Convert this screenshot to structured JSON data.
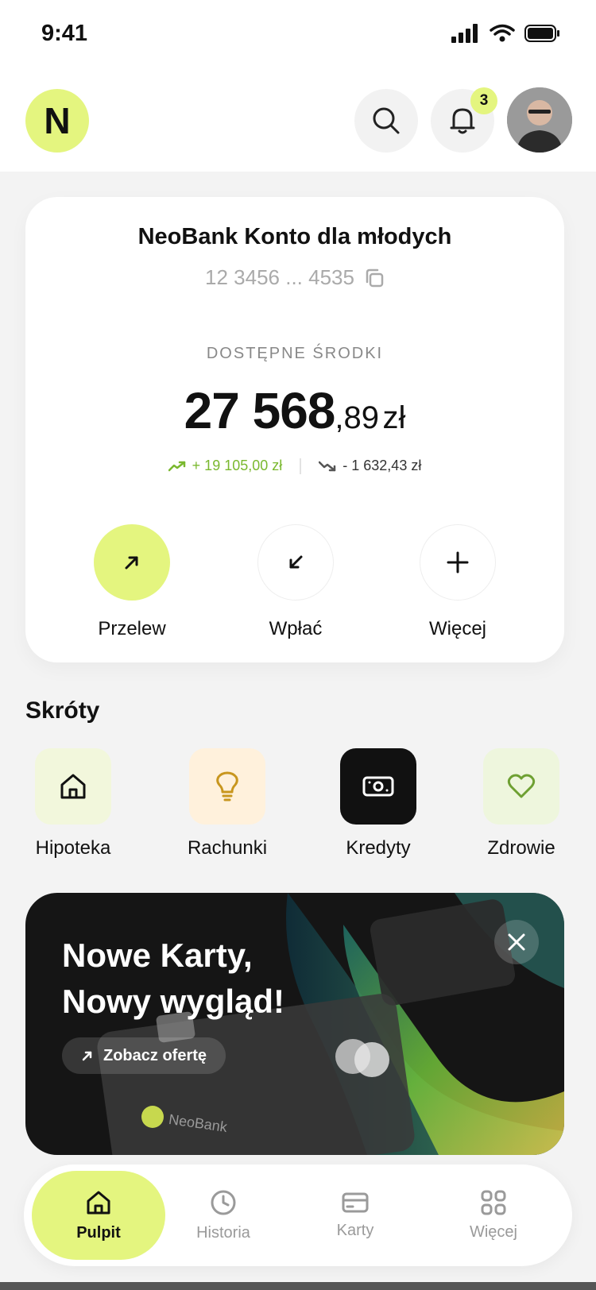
{
  "status_bar": {
    "time": "9:41"
  },
  "header": {
    "logo_letter": "N",
    "notification_count": "3"
  },
  "account": {
    "name": "NeoBank Konto dla młodych",
    "number": "12 3456 ... 4535",
    "balance_label": "DOSTĘPNE ŚRODKI",
    "balance_main": "27 568",
    "balance_cents": ",89",
    "currency": "zł",
    "income": "+ 19 105,00 zł",
    "expense": "- 1 632,43 zł"
  },
  "actions": [
    {
      "label": "Przelew",
      "icon": "arrow-up-right-icon"
    },
    {
      "label": "Wpłać",
      "icon": "arrow-down-left-icon"
    },
    {
      "label": "Więcej",
      "icon": "plus-icon"
    }
  ],
  "shortcuts": {
    "title": "Skróty",
    "items": [
      {
        "label": "Hipoteka",
        "icon": "house-icon",
        "bg": "#f2f7dc"
      },
      {
        "label": "Rachunki",
        "icon": "lightbulb-icon",
        "bg": "#fff1dc"
      },
      {
        "label": "Kredyty",
        "icon": "banknote-icon",
        "bg": "#111111"
      },
      {
        "label": "Zdrowie",
        "icon": "heart-icon",
        "bg": "#eef6dd"
      }
    ]
  },
  "promo": {
    "title_line1": "Nowe Karty,",
    "title_line2": "Nowy wygląd!",
    "cta": "Zobacz ofertę",
    "card_brand": "NeoBank"
  },
  "nav": {
    "items": [
      {
        "label": "Pulpit",
        "icon": "home-icon",
        "active": true
      },
      {
        "label": "Historia",
        "icon": "clock-icon",
        "active": false
      },
      {
        "label": "Karty",
        "icon": "card-icon",
        "active": false
      },
      {
        "label": "Więcej",
        "icon": "grid-icon",
        "active": false
      }
    ]
  },
  "colors": {
    "accent": "#e4f57f",
    "income": "#7ab82f",
    "background": "#f3f3f3"
  }
}
